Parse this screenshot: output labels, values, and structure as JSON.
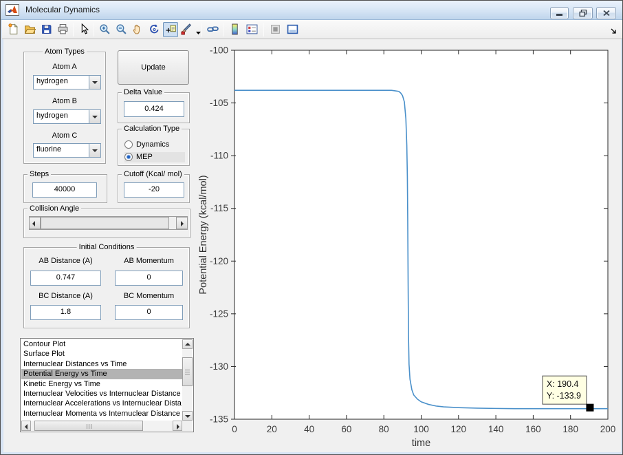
{
  "window": {
    "title": "Molecular Dynamics",
    "controls": {
      "minimize": "minimize",
      "restore": "restore",
      "close": "close"
    }
  },
  "toolbar": {
    "items": [
      {
        "name": "new-figure-icon"
      },
      {
        "name": "open-file-icon"
      },
      {
        "name": "save-figure-icon"
      },
      {
        "name": "print-figure-icon"
      },
      {
        "name": "separator"
      },
      {
        "name": "pointer-icon"
      },
      {
        "name": "separator"
      },
      {
        "name": "zoom-in-icon"
      },
      {
        "name": "zoom-out-icon"
      },
      {
        "name": "pan-icon"
      },
      {
        "name": "rotate-3d-icon"
      },
      {
        "name": "data-cursor-icon",
        "selected": true
      },
      {
        "name": "brush-icon",
        "dropdown": true
      },
      {
        "name": "separator"
      },
      {
        "name": "link-plot-icon"
      },
      {
        "name": "separator"
      },
      {
        "name": "colorbar-icon"
      },
      {
        "name": "legend-icon"
      },
      {
        "name": "separator"
      },
      {
        "name": "hide-plot-tools-icon"
      },
      {
        "name": "show-plot-tools-icon"
      }
    ]
  },
  "controls": {
    "atom_types": {
      "label": "Atom Types",
      "fields": [
        {
          "label": "Atom A",
          "value": "hydrogen"
        },
        {
          "label": "Atom B",
          "value": "hydrogen"
        },
        {
          "label": "Atom C",
          "value": "fluorine"
        }
      ]
    },
    "update_button": "Update",
    "delta_value": {
      "label": "Delta Value",
      "value": "0.424"
    },
    "calculation_type": {
      "label": "Calculation Type",
      "options": [
        {
          "label": "Dynamics",
          "selected": false
        },
        {
          "label": "MEP",
          "selected": true
        }
      ]
    },
    "steps": {
      "label": "Steps",
      "value": "40000"
    },
    "cutoff": {
      "label": "Cutoff (Kcal/ mol)",
      "value": "-20"
    },
    "collision_angle": {
      "label": "Collision Angle"
    },
    "initial_conditions": {
      "label": "Initial Conditions",
      "fields": [
        {
          "label": "AB Distance (A)",
          "value": "0.747"
        },
        {
          "label": "AB Momentum",
          "value": "0"
        },
        {
          "label": "BC Distance (A)",
          "value": "1.8"
        },
        {
          "label": "BC Momentum",
          "value": "0"
        }
      ]
    },
    "plot_list": {
      "items": [
        "Contour Plot",
        "Surface Plot",
        "Internuclear Distances vs Time",
        "Potential Energy vs Time",
        "Kinetic Energy vs Time",
        "Internuclear Velocities vs Internuclear Distance",
        "Internuclear Accelerations vs Internuclear Dista",
        "Internuclear Momenta vs Internuclear Distance"
      ],
      "selected_index": 3
    }
  },
  "chart_data": {
    "type": "line",
    "xlabel": "time",
    "ylabel": "Potential Energy (kcal/mol)",
    "xlim": [
      0,
      200
    ],
    "ylim": [
      -135,
      -100
    ],
    "xticks": [
      0,
      20,
      40,
      60,
      80,
      100,
      120,
      140,
      160,
      180,
      200
    ],
    "yticks": [
      -135,
      -130,
      -125,
      -120,
      -115,
      -110,
      -105,
      -100
    ],
    "line_color": "#4a90ca",
    "grid": false,
    "series": [
      {
        "name": "Potential Energy",
        "x": [
          0,
          10,
          20,
          30,
          40,
          50,
          60,
          70,
          80,
          84,
          86,
          88,
          89,
          90,
          91,
          91.8,
          92.3,
          92.6,
          92.8,
          93,
          93.2,
          93.5,
          94,
          95,
          96,
          98,
          100,
          104,
          108,
          112,
          120,
          130,
          140,
          150,
          160,
          170,
          180,
          190,
          200
        ],
        "y": [
          -103.8,
          -103.8,
          -103.8,
          -103.8,
          -103.8,
          -103.8,
          -103.8,
          -103.8,
          -103.8,
          -103.8,
          -103.85,
          -103.9,
          -104.05,
          -104.3,
          -104.9,
          -106.5,
          -109,
          -112,
          -116,
          -122,
          -127,
          -129.8,
          -131.2,
          -132.2,
          -132.7,
          -133.1,
          -133.35,
          -133.6,
          -133.75,
          -133.83,
          -133.9,
          -133.95,
          -133.98,
          -134,
          -134,
          -134,
          -134,
          -134,
          -134
        ]
      }
    ],
    "datatip": {
      "x": 190.4,
      "y": -133.9,
      "lines": [
        "X: 190.4",
        "Y: -133.9"
      ]
    }
  }
}
